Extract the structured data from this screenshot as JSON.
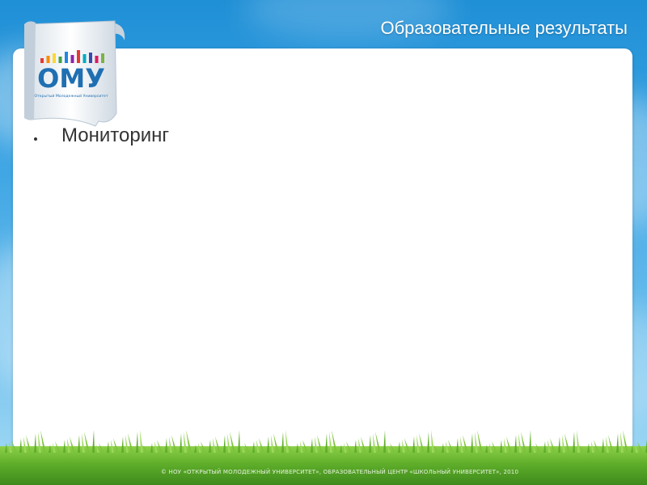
{
  "slide": {
    "title": "Образовательные результаты",
    "bullets": [
      "Мониторинг"
    ],
    "footer": "© НОУ «ОТКРЫТЫЙ МОЛОДЕЖНЫЙ УНИВЕРСИТЕТ», ОБРАЗОВАТЕЛЬНЫЙ ЦЕНТР «ШКОЛЬНЫЙ УНИВЕРСИТЕТ», 2010"
  },
  "logo": {
    "text": "ОМУ",
    "subtitle": "Открытый Молодежный Университет",
    "colors": [
      "#e53935",
      "#fb8c00",
      "#fdd835",
      "#43a047",
      "#1e88e5",
      "#8e24aa",
      "#e53935",
      "#00acc1",
      "#3949ab",
      "#d81b60",
      "#7cb342"
    ]
  },
  "colors": {
    "sky": "#2d9ee0",
    "logo_blue": "#1f6fb2",
    "panel": "#ffffff",
    "grass": "#5fae2a"
  }
}
